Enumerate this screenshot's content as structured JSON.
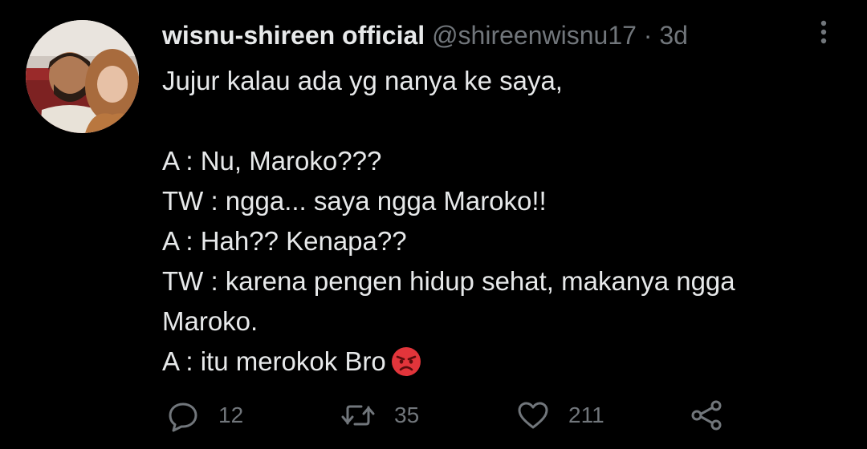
{
  "tweet": {
    "display_name": "wisnu-shireen official",
    "handle": "@shireenwisnu17",
    "separator": "·",
    "time": "3d",
    "lines": [
      "Jujur kalau ada yg nanya ke saya,",
      "",
      "A : Nu, Maroko???",
      "TW : ngga... saya ngga Maroko!!",
      "A : Hah?? Kenapa??",
      "TW : karena pengen hidup sehat, makanya ngga",
      "Maroko.",
      "A : itu merokok Bro"
    ],
    "trailing_emoji": "angry-face-emoji"
  },
  "actions": {
    "replies": "12",
    "retweets": "35",
    "likes": "211"
  },
  "icons": {
    "more": "more-vertical-icon",
    "reply": "reply-icon",
    "retweet": "retweet-icon",
    "like": "heart-icon",
    "share": "share-icon"
  },
  "colors": {
    "background": "#000000",
    "text": "#e7e9ea",
    "secondary": "#71767b",
    "emoji_red": "#e2353b"
  }
}
